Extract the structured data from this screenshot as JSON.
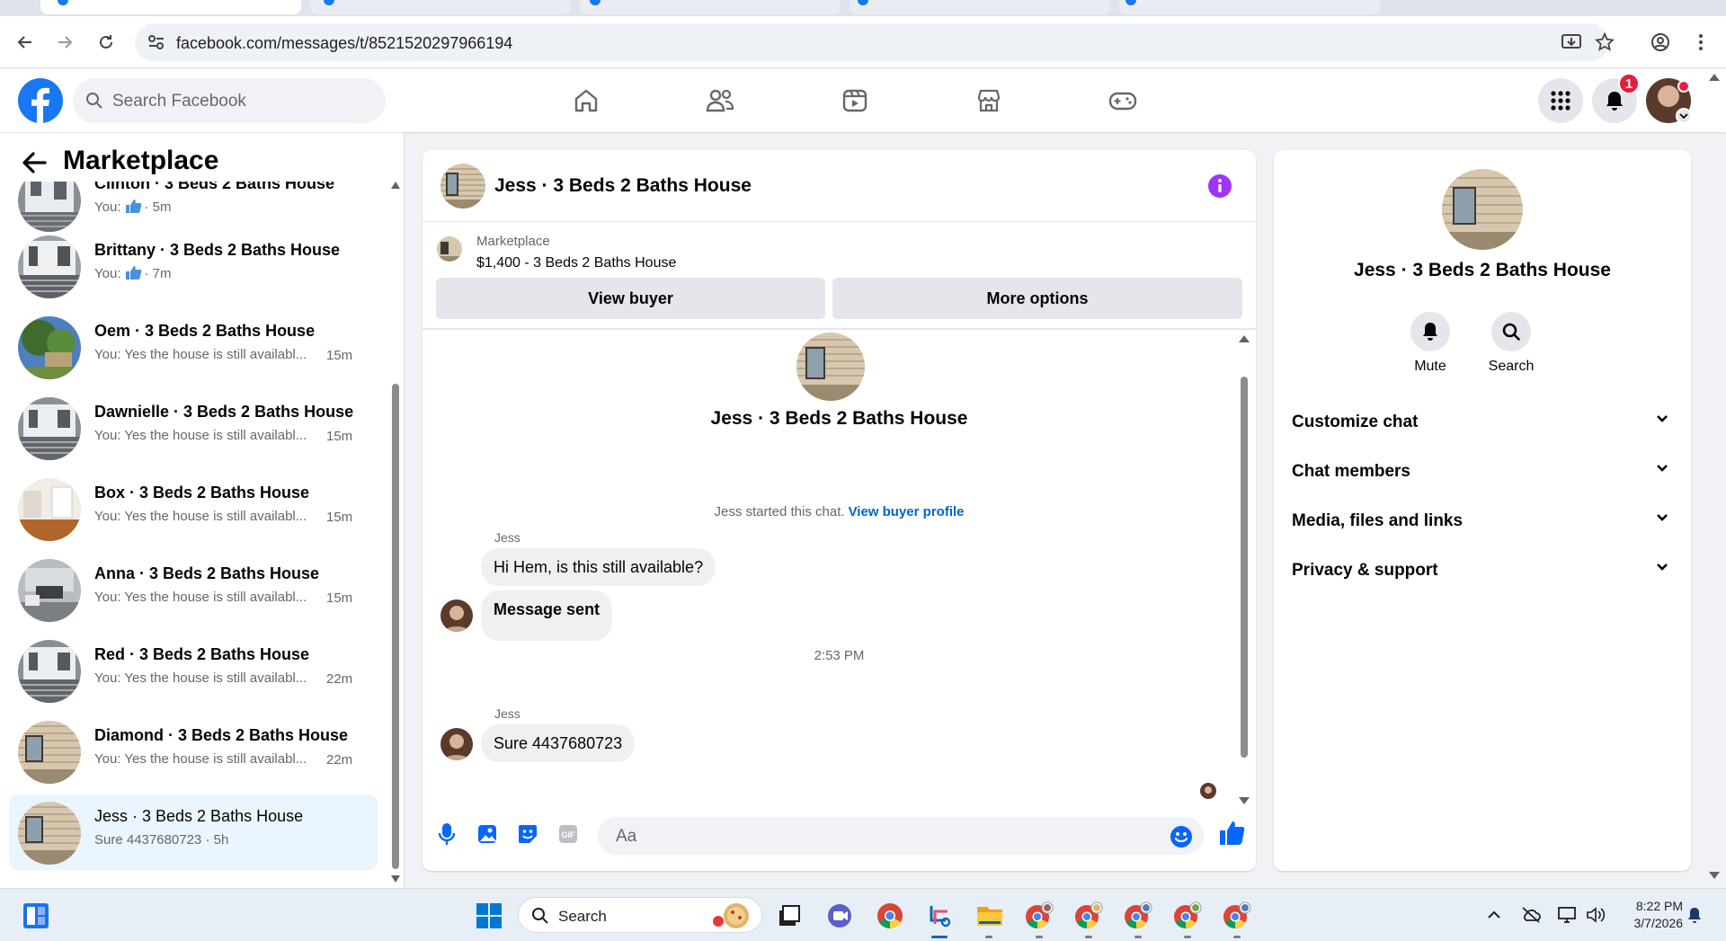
{
  "browser": {
    "url": "facebook.com/messages/t/8521520297966194"
  },
  "header": {
    "search_placeholder": "Search Facebook",
    "notification_count": "1"
  },
  "sidebar": {
    "title": "Marketplace",
    "conversations": [
      {
        "name": "Clinton · 3 Beds 2 Baths House",
        "preview": "You:",
        "has_like": true,
        "time": "· 5m",
        "thumb": "porch"
      },
      {
        "name": "Brittany · 3 Beds 2 Baths House",
        "preview": "You:",
        "has_like": true,
        "time": "· 7m",
        "thumb": "porch"
      },
      {
        "name": "Oem · 3 Beds 2 Baths House",
        "preview": "You: Yes the house is still availabl...",
        "has_like": false,
        "time": "15m",
        "thumb": "tree"
      },
      {
        "name": "Dawnielle · 3 Beds 2 Baths House",
        "preview": "You: Yes the house is still availabl...",
        "has_like": false,
        "time": "15m",
        "thumb": "porch"
      },
      {
        "name": "Box · 3 Beds 2 Baths House",
        "preview": "You: Yes the house is still availabl...",
        "has_like": false,
        "time": "15m",
        "thumb": "interior"
      },
      {
        "name": "Anna · 3 Beds 2 Baths House",
        "preview": "You: Yes the house is still availabl...",
        "has_like": false,
        "time": "15m",
        "thumb": "living"
      },
      {
        "name": "Red · 3 Beds 2 Baths House",
        "preview": "You: Yes the house is still availabl...",
        "has_like": false,
        "time": "22m",
        "thumb": "porch"
      },
      {
        "name": "Diamond · 3 Beds 2 Baths House",
        "preview": "You: Yes the house is still availabl...",
        "has_like": false,
        "time": "22m",
        "thumb": "siding"
      },
      {
        "name": "Jess · 3 Beds 2 Baths House",
        "preview": "Sure 4437680723 · 5h",
        "has_like": false,
        "time": "",
        "thumb": "siding",
        "selected": true
      }
    ]
  },
  "chat": {
    "title": "Jess · 3 Beds 2 Baths House",
    "listing_category": "Marketplace",
    "listing_price": "$1,400 - 3 Beds 2 Baths House",
    "view_buyer_label": "View buyer",
    "more_options_label": "More options",
    "profile_name": "Jess · 3 Beds 2 Baths House",
    "started_text": "Jess started this chat.",
    "view_buyer_profile": "View buyer profile",
    "sender": "Jess",
    "msg1": "Hi Hem, is this still available?",
    "msg2": "Message sent",
    "timestamp": "2:53 PM",
    "sender2": "Jess",
    "msg3": "Sure 4437680723",
    "composer_placeholder": "Aa"
  },
  "info_panel": {
    "name": "Jess · 3 Beds 2 Baths House",
    "mute_label": "Mute",
    "search_label": "Search",
    "sections": [
      "Customize chat",
      "Chat members",
      "Media, files and links",
      "Privacy & support"
    ]
  },
  "taskbar": {
    "search_placeholder": "Search",
    "time": "8:22 PM",
    "date": "3/7/2026"
  },
  "colors": {
    "fb_blue": "#1877f2",
    "info_purple": "#a033ff",
    "selected_row": "#ebf5ff"
  }
}
